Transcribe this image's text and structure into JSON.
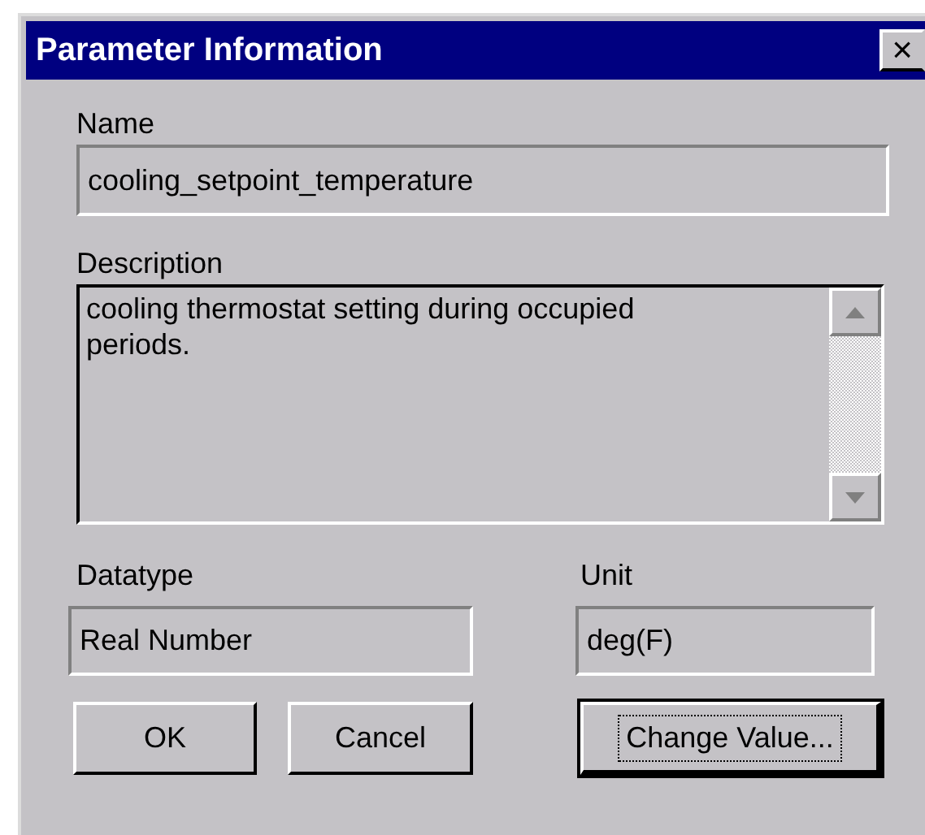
{
  "window": {
    "title": "Parameter Information",
    "close": "×"
  },
  "name": {
    "label": "Name",
    "value": "cooling_setpoint_temperature"
  },
  "description": {
    "label": "Description",
    "value": "cooling thermostat setting during occupied periods."
  },
  "datatype": {
    "label": "Datatype",
    "value": "Real Number"
  },
  "unit": {
    "label": "Unit",
    "value": "deg(F)"
  },
  "buttons": [
    {
      "label": "OK",
      "focused": false
    },
    {
      "label": "Cancel",
      "focused": false
    },
    {
      "label": "Change Value...",
      "focused": true
    }
  ]
}
